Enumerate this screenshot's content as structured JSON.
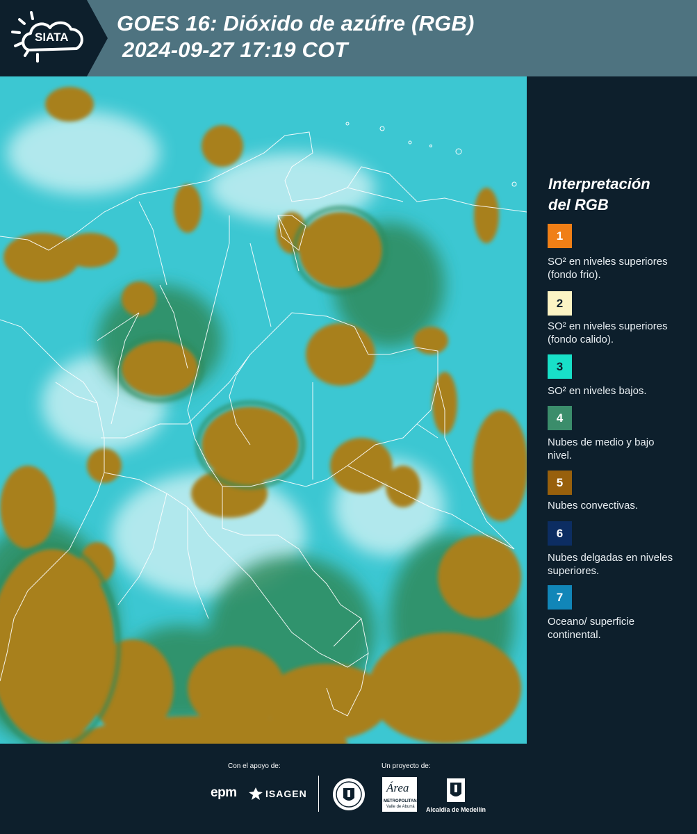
{
  "header": {
    "logo_text": "SIATA",
    "title_line1": "GOES 16: Dióxido de azúfre (RGB)",
    "title_line2": "2024-09-27 17:19 COT"
  },
  "legend": {
    "title_line1": "Interpretación",
    "title_line2": "del RGB",
    "items": [
      {
        "number": "1",
        "color": "#f07f16",
        "text": "SO² en niveles superiores (fondo frio)."
      },
      {
        "number": "2",
        "color": "#fcf4c4",
        "text": "SO² en niveles superiores (fondo calido)."
      },
      {
        "number": "3",
        "color": "#18e0c8",
        "text": "SO² en niveles bajos."
      },
      {
        "number": "4",
        "color": "#3b8d6b",
        "text": "Nubes de medio y bajo nivel."
      },
      {
        "number": "5",
        "color": "#98600c",
        "text": "Nubes convectivas."
      },
      {
        "number": "6",
        "color": "#0c2d62",
        "text": "Nubes delgadas en niveles superiores."
      },
      {
        "number": "7",
        "color": "#1186b8",
        "text": "Oceano/ superficie continental."
      }
    ]
  },
  "footer": {
    "support_label": "Con el apoyo de:",
    "project_label": "Un proyecto de:",
    "sponsor_epm": "epm",
    "sponsor_isagen": "ISAGEN",
    "org_area_name": "Área",
    "org_area_sub1": "METROPOLITANA",
    "org_area_sub2": "Valle de Aburrá",
    "org_alcaldia": "Alcaldía de Medellín"
  },
  "colors": {
    "header_bg": "#4e7380",
    "panel_bg": "#0d1f2c",
    "map_cyan": "#3cc7d2",
    "map_brown": "#a8801c",
    "map_green": "#2f8a5c"
  }
}
